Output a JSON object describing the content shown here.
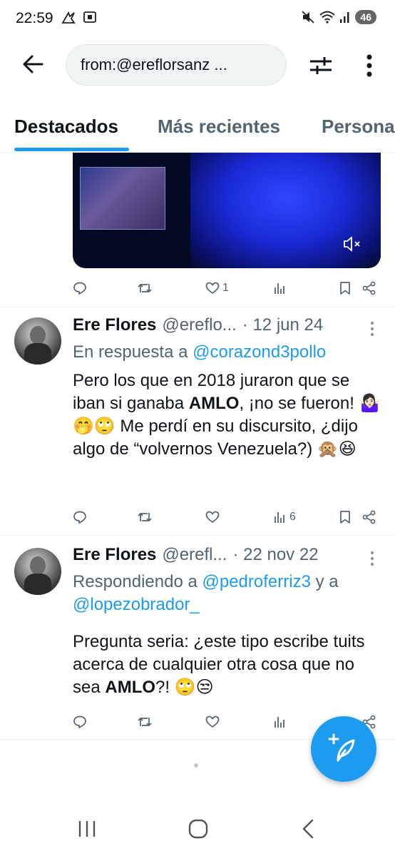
{
  "status_bar": {
    "time": "22:59",
    "battery": "46"
  },
  "search": {
    "query": "from:@ereflorsanz ..."
  },
  "tabs": [
    {
      "label": "Destacados"
    },
    {
      "label": "Más recientes"
    },
    {
      "label": "Persona"
    }
  ],
  "tweet_0": {
    "likes": "1"
  },
  "tweet_1": {
    "name": "Ere Flores",
    "handle": "@ereflo...",
    "date": "· 12 jun 24",
    "reply_prefix": "En respuesta a",
    "reply_to": "@corazond3pollo",
    "text_1": "Pero los que en 2018 juraron que se iban si ganaba",
    "text_bold": "AMLO",
    "text_2": ", ¡no se fueron! 🤷🏻‍♀️🤭🙄 Me perdí en su discursito, ¿dijo algo de “volvernos Venezuela?) 🙊😆",
    "views": "6"
  },
  "tweet_2": {
    "name": "Ere Flores",
    "handle": "@erefl...",
    "date": "· 22 nov 22",
    "reply_prefix": "Respondiendo a",
    "reply_to_1": "@pedroferriz3",
    "reply_joiner": "y a",
    "reply_to_2": "@lopezobrador_",
    "text_1": "Pregunta seria: ¿este tipo escribe tuits acerca de cualquier otra cosa que no sea",
    "text_bold": "AMLO",
    "text_2": "?! 🙄😒"
  },
  "colors": {
    "accent": "#1d9bf0",
    "secondary_text": "#536471",
    "primary_text": "#0f1419"
  },
  "icons": [
    "back-arrow-icon",
    "filter-icon",
    "more-icon",
    "mute-icon",
    "reply-icon",
    "retweet-icon",
    "like-icon",
    "views-icon",
    "bookmark-icon",
    "share-icon",
    "compose-icon"
  ]
}
